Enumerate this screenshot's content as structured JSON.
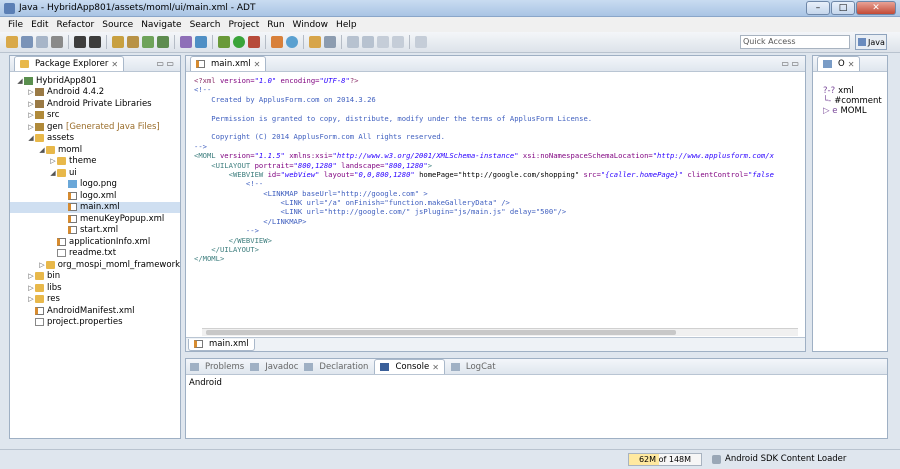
{
  "window": {
    "title": "Java - HybridApp801/assets/moml/ui/main.xml - ADT"
  },
  "window_buttons": {
    "minimize": "–",
    "maximize": "□",
    "close": "✕"
  },
  "menu": [
    "File",
    "Edit",
    "Refactor",
    "Source",
    "Navigate",
    "Search",
    "Project",
    "Run",
    "Window",
    "Help"
  ],
  "quick_access": {
    "placeholder": "Quick Access"
  },
  "perspective": {
    "label": "Java"
  },
  "package_explorer": {
    "title": "Package Explorer",
    "close_glyph": "✕",
    "tree": [
      {
        "label": "HybridApp801",
        "depth": 0,
        "arrow": "◢",
        "icon": "project"
      },
      {
        "label": "Android 4.4.2",
        "depth": 1,
        "arrow": "▷",
        "icon": "lib"
      },
      {
        "label": "Android Private Libraries",
        "depth": 1,
        "arrow": "▷",
        "icon": "lib"
      },
      {
        "label": "src",
        "depth": 1,
        "arrow": "▷",
        "icon": "pkg"
      },
      {
        "label": "gen",
        "depth": 1,
        "arrow": "▷",
        "icon": "pkg",
        "suffix": "[Generated Java Files]"
      },
      {
        "label": "assets",
        "depth": 1,
        "arrow": "◢",
        "icon": "folder"
      },
      {
        "label": "moml",
        "depth": 2,
        "arrow": "◢",
        "icon": "folder"
      },
      {
        "label": "theme",
        "depth": 3,
        "arrow": "▷",
        "icon": "folder"
      },
      {
        "label": "ui",
        "depth": 3,
        "arrow": "◢",
        "icon": "folder"
      },
      {
        "label": "logo.png",
        "depth": 4,
        "arrow": "",
        "icon": "img"
      },
      {
        "label": "logo.xml",
        "depth": 4,
        "arrow": "",
        "icon": "xml"
      },
      {
        "label": "main.xml",
        "depth": 4,
        "arrow": "",
        "icon": "xml",
        "selected": true
      },
      {
        "label": "menuKeyPopup.xml",
        "depth": 4,
        "arrow": "",
        "icon": "xml"
      },
      {
        "label": "start.xml",
        "depth": 4,
        "arrow": "",
        "icon": "xml"
      },
      {
        "label": "applicationInfo.xml",
        "depth": 3,
        "arrow": "",
        "icon": "xml"
      },
      {
        "label": "readme.txt",
        "depth": 3,
        "arrow": "",
        "icon": "file"
      },
      {
        "label": "org_mospi_moml_framework",
        "depth": 2,
        "arrow": "▷",
        "icon": "folder"
      },
      {
        "label": "bin",
        "depth": 1,
        "arrow": "▷",
        "icon": "folder"
      },
      {
        "label": "libs",
        "depth": 1,
        "arrow": "▷",
        "icon": "folder"
      },
      {
        "label": "res",
        "depth": 1,
        "arrow": "▷",
        "icon": "folder"
      },
      {
        "label": "AndroidManifest.xml",
        "depth": 1,
        "arrow": "",
        "icon": "xml"
      },
      {
        "label": "project.properties",
        "depth": 1,
        "arrow": "",
        "icon": "file"
      }
    ]
  },
  "editor": {
    "tab": "main.xml",
    "close_glyph": "✕",
    "bottom_tab": "main.xml",
    "lines": [
      [
        {
          "t": "<?xml ",
          "c": "pi"
        },
        {
          "t": "version=",
          "c": "attr"
        },
        {
          "t": "\"1.0\"",
          "c": "str"
        },
        {
          "t": " encoding=",
          "c": "attr"
        },
        {
          "t": "\"UTF-8\"",
          "c": "str"
        },
        {
          "t": "?>",
          "c": "pi"
        }
      ],
      [
        {
          "t": "<!--",
          "c": "cmt"
        }
      ],
      [
        {
          "t": "    Created by ApplusForm.com on 2014.3.26",
          "c": "cmt"
        }
      ],
      [
        {
          "t": "",
          "c": "cmt"
        }
      ],
      [
        {
          "t": "    Permission is granted to copy, distribute, modify under the terms of ApplusForm License.",
          "c": "cmt"
        }
      ],
      [
        {
          "t": "",
          "c": "cmt"
        }
      ],
      [
        {
          "t": "    Copyright (C) 2014 ApplusForm.com All rights reserved.",
          "c": "cmt"
        }
      ],
      [
        {
          "t": "-->",
          "c": "cmt"
        }
      ],
      [
        {
          "t": "<MOML ",
          "c": "tag"
        },
        {
          "t": "version=",
          "c": "attr"
        },
        {
          "t": "\"1.1.5\"",
          "c": "str"
        },
        {
          "t": " xmlns:xsi=",
          "c": "attr"
        },
        {
          "t": "\"http://www.w3.org/2001/XMLSchema-instance\"",
          "c": "str"
        },
        {
          "t": " xsi:noNamespaceSchemaLocation=",
          "c": "attr"
        },
        {
          "t": "\"http://www.applusform.com/x",
          "c": "str"
        }
      ],
      [
        {
          "t": "    <UILAYOUT ",
          "c": "tag"
        },
        {
          "t": "portrait=",
          "c": "attr"
        },
        {
          "t": "\"800,1280\"",
          "c": "str"
        },
        {
          "t": " landscape=",
          "c": "attr"
        },
        {
          "t": "\"800,1280\"",
          "c": "str"
        },
        {
          "t": ">",
          "c": "tag"
        }
      ],
      [
        {
          "t": "        <WEBVIEW ",
          "c": "tag"
        },
        {
          "t": "id=",
          "c": "attr"
        },
        {
          "t": "\"webView\"",
          "c": "str"
        },
        {
          "t": " layout=",
          "c": "attr"
        },
        {
          "t": "\"0,0,800,1280\"",
          "c": "str"
        },
        {
          "t": " ",
          "c": "tag"
        },
        {
          "t": "homePage=\"http://google.com/shopping\"",
          "c": "hl"
        },
        {
          "t": " src=",
          "c": "attr"
        },
        {
          "t": "\"{caller.homePage}\"",
          "c": "str"
        },
        {
          "t": " clientControl=",
          "c": "attr"
        },
        {
          "t": "\"false",
          "c": "str"
        }
      ],
      [
        {
          "t": "            <!--",
          "c": "cmt"
        }
      ],
      [
        {
          "t": "                <LINKMAP baseUrl=\"http://google.com\" >",
          "c": "cmt"
        }
      ],
      [
        {
          "t": "                    <LINK url=\"/a\" onFinish=\"function.makeGalleryData\" />",
          "c": "cmt"
        }
      ],
      [
        {
          "t": "                    <LINK url=\"http://google.com/\" jsPlugin=\"js/main.js\" delay=\"500\"/>",
          "c": "cmt"
        }
      ],
      [
        {
          "t": "                </LINKMAP>",
          "c": "cmt"
        }
      ],
      [
        {
          "t": "            -->",
          "c": "cmt"
        }
      ],
      [
        {
          "t": "        </WEBVIEW>",
          "c": "tag"
        }
      ],
      [
        {
          "t": "    </UILAYOUT>",
          "c": "tag"
        }
      ],
      [
        {
          "t": "</MOML>",
          "c": "tag"
        }
      ]
    ]
  },
  "outline": {
    "title": "O",
    "items": [
      {
        "icon": "?-?",
        "label": "xml"
      },
      {
        "icon": "└-",
        "label": "#comment"
      },
      {
        "icon": "▷ e",
        "label": "MOML"
      }
    ]
  },
  "bottom_panel": {
    "tabs": [
      {
        "label": "Problems",
        "active": false
      },
      {
        "label": "Javadoc",
        "active": false
      },
      {
        "label": "Declaration",
        "active": false
      },
      {
        "label": "Console",
        "active": true
      },
      {
        "label": "LogCat",
        "active": false
      }
    ],
    "close_glyph": "✕",
    "console_text": "Android"
  },
  "status": {
    "memory_used": "62M",
    "memory_of": "of 148M",
    "memory_fraction": 0.42,
    "loader": "Android SDK Content Loader"
  },
  "colors": {
    "highlight": "#ffff3a",
    "selection": "#cfdff1",
    "accent": "#5b7fb5"
  }
}
